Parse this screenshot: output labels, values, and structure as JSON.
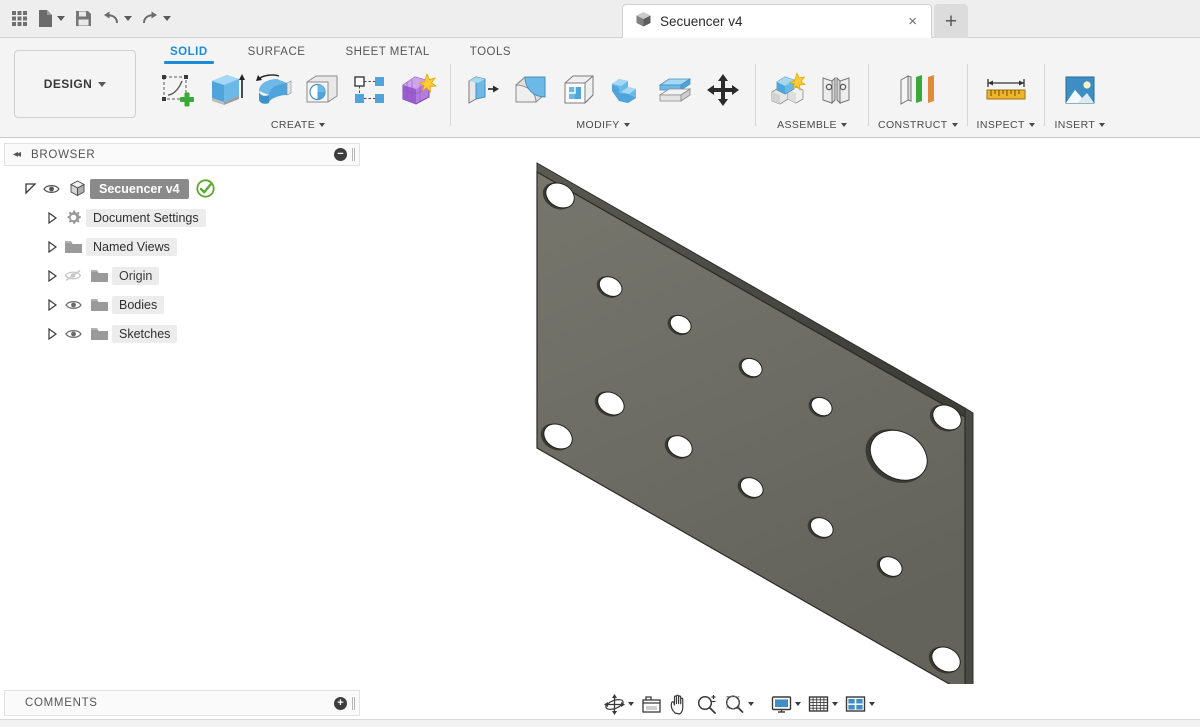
{
  "app": {
    "document_tab": {
      "title": "Secuencer v4",
      "close_label": "×",
      "icon": "cube-icon"
    },
    "new_tab_label": "+"
  },
  "quick_access": [
    {
      "name": "app-grid-icon",
      "label": ""
    },
    {
      "name": "new-document-icon",
      "label": "",
      "has_caret": true
    },
    {
      "name": "save-icon",
      "label": ""
    },
    {
      "name": "undo-icon",
      "label": "",
      "has_caret": true
    },
    {
      "name": "redo-icon",
      "label": "",
      "has_caret": true
    }
  ],
  "ribbon": {
    "workspace_button": "DESIGN",
    "tabs": [
      {
        "label": "SOLID",
        "active": true
      },
      {
        "label": "SURFACE",
        "active": false
      },
      {
        "label": "SHEET METAL",
        "active": false
      },
      {
        "label": "TOOLS",
        "active": false
      }
    ],
    "panels": [
      {
        "label": "CREATE",
        "has_caret": true,
        "tools": [
          "create-sketch-icon",
          "extrude-icon",
          "revolve-icon",
          "sweep-icon",
          "pattern-icon",
          "automate-icon"
        ]
      },
      {
        "label": "MODIFY",
        "has_caret": true,
        "tools": [
          "press-pull-icon",
          "fillet-icon",
          "shell-icon",
          "combine-icon",
          "offset-face-icon",
          "move-copy-icon"
        ]
      },
      {
        "label": "ASSEMBLE",
        "has_caret": true,
        "tools": [
          "new-component-icon",
          "joint-icon"
        ]
      },
      {
        "label": "CONSTRUCT",
        "has_caret": true,
        "tools": [
          "offset-plane-icon"
        ]
      },
      {
        "label": "INSPECT",
        "has_caret": true,
        "tools": [
          "measure-icon"
        ]
      },
      {
        "label": "INSERT",
        "has_caret": true,
        "tools": [
          "insert-image-icon"
        ]
      }
    ]
  },
  "browser": {
    "header": {
      "title": "BROWSER",
      "collapse_label": "−",
      "collapse_arrows": "◂◂"
    },
    "root": {
      "label": "Secuencer v4",
      "icon": "cube-icon",
      "status": "green-check-icon",
      "visible": true,
      "expanded": true
    },
    "items": [
      {
        "label": "Document Settings",
        "icon": "gear-icon",
        "has_eye": false,
        "eye_state": "none",
        "expanded": false
      },
      {
        "label": "Named Views",
        "icon": "folder-icon",
        "has_eye": false,
        "eye_state": "none",
        "expanded": false
      },
      {
        "label": "Origin",
        "icon": "folder-icon",
        "has_eye": true,
        "eye_state": "hidden",
        "expanded": false
      },
      {
        "label": "Bodies",
        "icon": "folder-icon",
        "has_eye": true,
        "eye_state": "visible",
        "expanded": false
      },
      {
        "label": "Sketches",
        "icon": "folder-icon",
        "has_eye": true,
        "eye_state": "visible",
        "expanded": false
      }
    ]
  },
  "comments": {
    "title": "COMMENTS",
    "add_label": "+"
  },
  "navbar": [
    {
      "name": "orbit-icon",
      "has_caret": true
    },
    {
      "name": "look-at-icon",
      "has_caret": false
    },
    {
      "name": "pan-icon",
      "has_caret": false
    },
    {
      "name": "zoom-icon",
      "has_caret": false
    },
    {
      "name": "zoom-fit-icon",
      "has_caret": true
    },
    {
      "name": "display-settings-icon",
      "has_caret": true
    },
    {
      "name": "grid-snaps-icon",
      "has_caret": true
    },
    {
      "name": "viewports-icon",
      "has_caret": true
    }
  ],
  "model": {
    "name": "perforated-plate",
    "face_color": "#6e6e66",
    "edge_color": "#2c2c28",
    "hole_fill": "#ffffff",
    "background": "#ffffff",
    "description": "Isometric view of a rectangular perforated mounting plate with 13 small holes and 1 large hole"
  },
  "colors": {
    "accent_blue": "#1a8cdb",
    "ribbon_bg": "#f4f4f4",
    "titlebar_bg": "#eeeeee",
    "panel_bg": "#fafafa",
    "selection_gray": "#8a8a8a",
    "status_green": "#5aa832"
  }
}
